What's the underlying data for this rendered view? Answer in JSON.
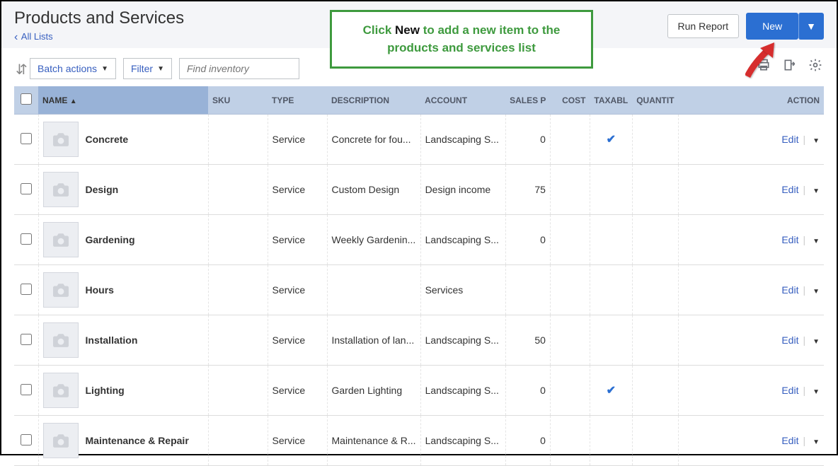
{
  "header": {
    "title": "Products and Services",
    "back_link": "All Lists",
    "run_report": "Run Report",
    "new": "New"
  },
  "toolbar": {
    "batch_actions": "Batch actions",
    "filter": "Filter",
    "search_placeholder": "Find inventory"
  },
  "callout": {
    "pre": "Click ",
    "kw": "New",
    "post": " to add a new item to the products and services list"
  },
  "columns": {
    "name": "NAME",
    "sku": "SKU",
    "type": "TYPE",
    "desc": "DESCRIPTION",
    "account": "ACCOUNT",
    "salesp": "SALES P",
    "cost": "COST",
    "taxable": "TAXABL",
    "qty": "QUANTIT",
    "action": "ACTION"
  },
  "sort_indicator": "▲",
  "action_label": "Edit",
  "rows": [
    {
      "name": "Concrete",
      "sku": "",
      "type": "Service",
      "desc": "Concrete for fou...",
      "account": "Landscaping S...",
      "salesp": "0",
      "cost": "",
      "taxable": true,
      "qty": ""
    },
    {
      "name": "Design",
      "sku": "",
      "type": "Service",
      "desc": "Custom Design",
      "account": "Design income",
      "salesp": "75",
      "cost": "",
      "taxable": false,
      "qty": ""
    },
    {
      "name": "Gardening",
      "sku": "",
      "type": "Service",
      "desc": "Weekly Gardenin...",
      "account": "Landscaping S...",
      "salesp": "0",
      "cost": "",
      "taxable": false,
      "qty": ""
    },
    {
      "name": "Hours",
      "sku": "",
      "type": "Service",
      "desc": "",
      "account": "Services",
      "salesp": "",
      "cost": "",
      "taxable": false,
      "qty": ""
    },
    {
      "name": "Installation",
      "sku": "",
      "type": "Service",
      "desc": "Installation of lan...",
      "account": "Landscaping S...",
      "salesp": "50",
      "cost": "",
      "taxable": false,
      "qty": ""
    },
    {
      "name": "Lighting",
      "sku": "",
      "type": "Service",
      "desc": "Garden Lighting",
      "account": "Landscaping S...",
      "salesp": "0",
      "cost": "",
      "taxable": true,
      "qty": ""
    },
    {
      "name": "Maintenance & Repair",
      "sku": "",
      "type": "Service",
      "desc": "Maintenance & R...",
      "account": "Landscaping S...",
      "salesp": "0",
      "cost": "",
      "taxable": false,
      "qty": ""
    }
  ]
}
